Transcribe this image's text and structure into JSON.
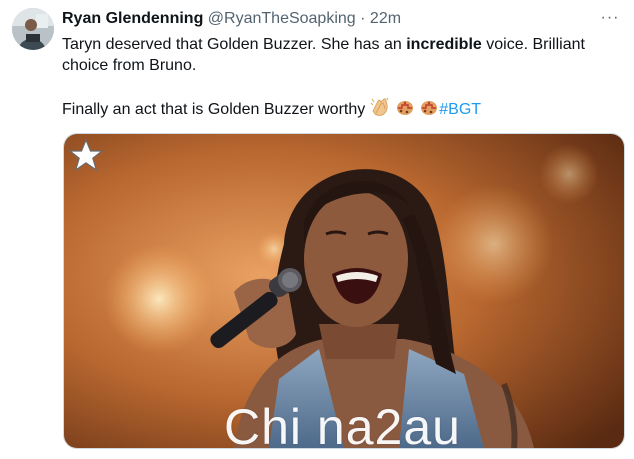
{
  "author": {
    "name": "Ryan Glendenning",
    "handle": "@RyanTheSoapking",
    "separator": "·",
    "timestamp": "22m"
  },
  "tweet": {
    "line1_pre": "Taryn deserved that Golden Buzzer. She has an ",
    "line1_bold": "incredible",
    "line1_post": " voice. Brilliant choice from Bruno.",
    "line2": "Finally an act that  is Golden Buzzer worthy",
    "hashtag": "#BGT",
    "emojis": [
      "clapping-hands-emoji",
      "cookie-emoji",
      "cookie-emoji"
    ]
  },
  "more_menu": {
    "label": "···"
  },
  "media": {
    "watermark": "Chi na2au",
    "badge_icon": "star-icon"
  },
  "colors": {
    "text": "#0f1419",
    "secondary": "#536471",
    "link": "#1d9bf0"
  }
}
